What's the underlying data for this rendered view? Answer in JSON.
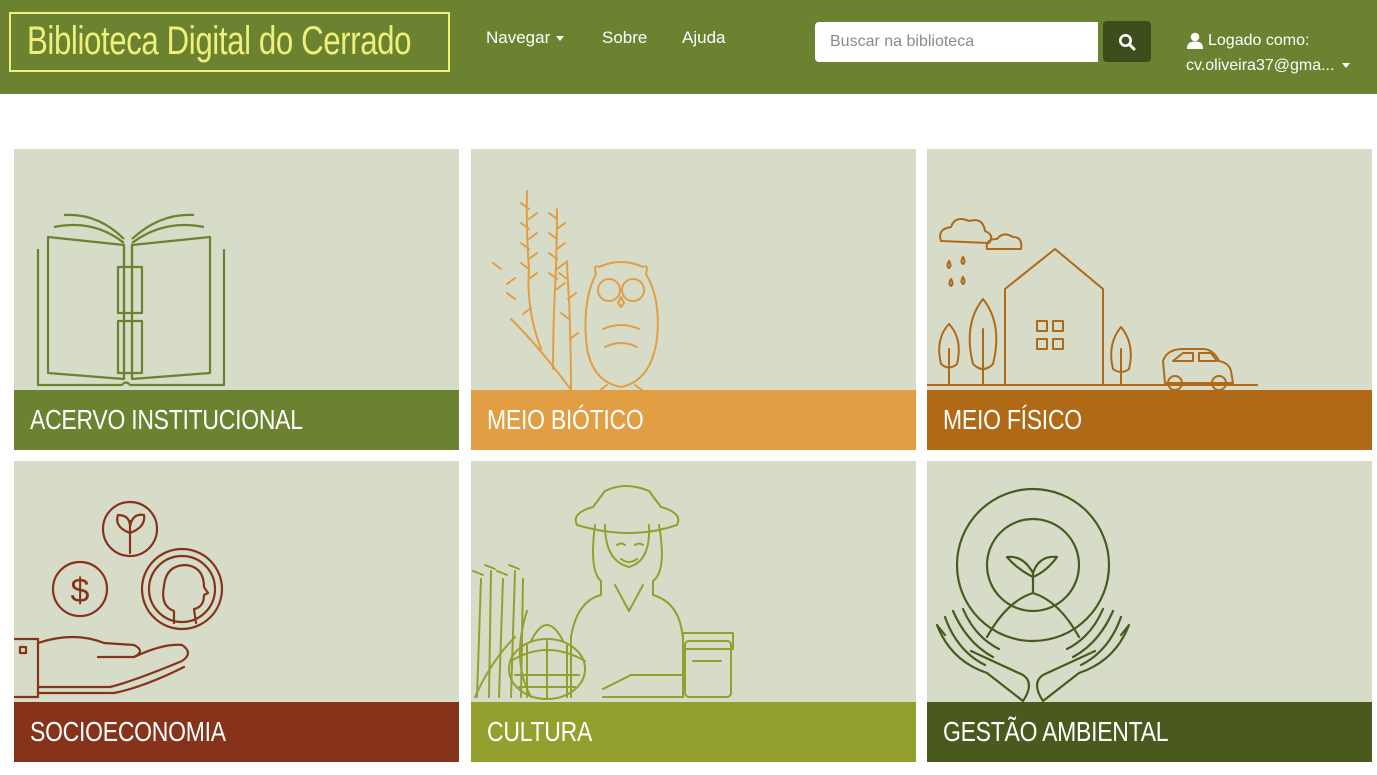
{
  "header": {
    "brand": "Biblioteca Digital do Cerrado",
    "nav": {
      "browse": "Navegar",
      "about": "Sobre",
      "help": "Ajuda"
    },
    "search": {
      "placeholder": "Buscar na biblioteca"
    },
    "user": {
      "logged_label": "Logado como:",
      "email": "cv.oliveira37@gma..."
    }
  },
  "tiles": [
    {
      "label": "ACERVO INSTITUCIONAL",
      "color": "#6b8231",
      "icon": "open-book-icon"
    },
    {
      "label": "MEIO BIÓTICO",
      "color": "#e29e43",
      "icon": "owl-and-plant-icon"
    },
    {
      "label": "MEIO FÍSICO",
      "color": "#b06a17",
      "icon": "house-trees-car-icon"
    },
    {
      "label": "SOCIOECONOMIA",
      "color": "#87331c",
      "icon": "hand-with-coins-icon"
    },
    {
      "label": "CULTURA",
      "color": "#93a02e",
      "icon": "farmer-with-basket-icon"
    },
    {
      "label": "GESTÃO AMBIENTAL",
      "color": "#4a5a1e",
      "icon": "hands-holding-sprout-icon"
    }
  ],
  "colors": {
    "navbar": "#6b8231",
    "brand": "#eef07a",
    "search_button": "#3e4d1c",
    "tile_bg": "#d6dcc7"
  }
}
